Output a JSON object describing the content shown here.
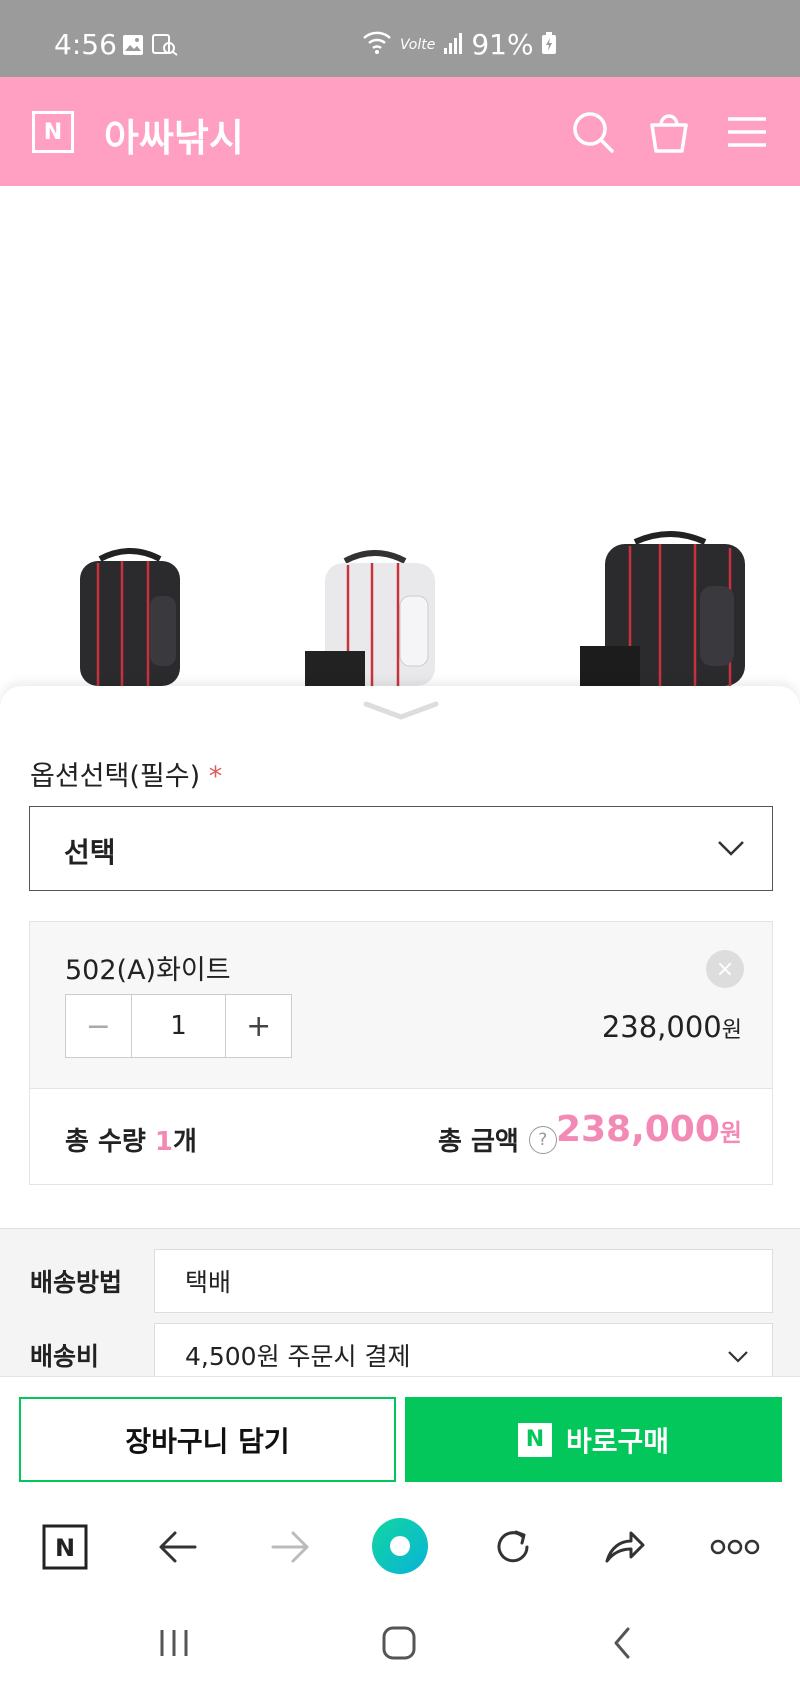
{
  "status_bar": {
    "time": "4:56",
    "volte": "Volte",
    "battery": "91%"
  },
  "header": {
    "logo_letter": "N",
    "store_name": "아싸낚시"
  },
  "options": {
    "label": "옵션선택(필수)",
    "required_mark": "*",
    "select_value": "선택"
  },
  "selected_item": {
    "name": "502(A)화이트",
    "remove_symbol": "×",
    "minus_symbol": "−",
    "quantity": "1",
    "plus_symbol": "+",
    "price": "238,000",
    "currency": "원"
  },
  "totals": {
    "qty_label": "총 수량",
    "qty_value": "1",
    "qty_unit": "개",
    "amount_label": "총 금액",
    "help_symbol": "?",
    "amount_value": "238,000",
    "currency": "원"
  },
  "shipping": {
    "method_label": "배송방법",
    "method_value": "택배",
    "fee_label": "배송비",
    "fee_value": "4,500원 주문시 결제"
  },
  "actions": {
    "cart_label": "장바구니 담기",
    "buy_badge": "N",
    "buy_label": "바로구매"
  },
  "browser_bar": {
    "home_letter": "N"
  },
  "colors": {
    "brand_pink": "#ff9fc2",
    "price_pink": "#f38ab6",
    "naver_green": "#03c75a",
    "status_gray": "#9b9b9b"
  },
  "icons": [
    "gallery-icon",
    "screenshot-search-icon",
    "wifi-icon",
    "signal-icon",
    "battery-charging-icon",
    "search-icon",
    "shopping-bag-icon",
    "menu-icon",
    "chevron-down-icon",
    "back-arrow-icon",
    "forward-arrow-icon",
    "green-dot-icon",
    "refresh-icon",
    "share-icon",
    "more-icon",
    "recent-apps-icon",
    "home-icon",
    "nav-back-icon"
  ]
}
